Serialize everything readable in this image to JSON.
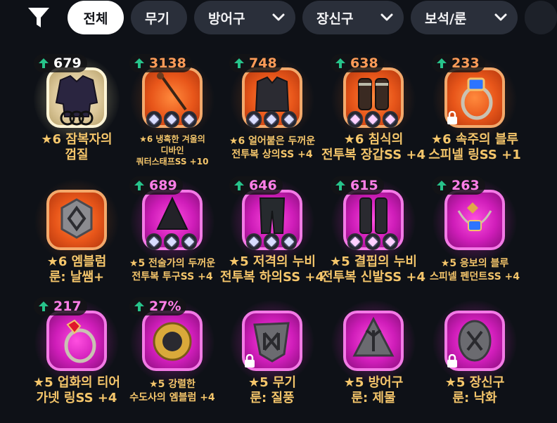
{
  "filters": {
    "all": "전체",
    "weapon": "무기",
    "armor": "방어구",
    "accessory": "장신구",
    "gem_rune": "보석/룬"
  },
  "items": [
    {
      "score": "679",
      "name_line1": "★6 잠복자의",
      "name_line2": "껍질",
      "grade": "gold",
      "score_color": "white"
    },
    {
      "score": "3138",
      "name_line1": "★6 냉혹한 겨울의",
      "name_line2": "디바인",
      "name_line3": "쿼터스태프SS +10",
      "grade": "orange",
      "score_color": "orange"
    },
    {
      "score": "748",
      "name_line1": "★6 얼어붙은 두꺼운",
      "name_line2": "전투복 상의SS +4",
      "grade": "orange",
      "score_color": "orange"
    },
    {
      "score": "638",
      "name_line1": "★6 침식의",
      "name_line2": "전투복 장갑SS +4",
      "grade": "orange",
      "score_color": "orange"
    },
    {
      "score": "233",
      "name_line1": "★6 속주의 블루",
      "name_line2": "스피넬 링SS +1",
      "grade": "orange",
      "score_color": "orange",
      "locked": true
    },
    {
      "score": "",
      "name_line1": "★6 엠블럼",
      "name_line2": "룬: 날쌤+",
      "grade": "orange",
      "score_color": "orange"
    },
    {
      "score": "689",
      "name_line1": "★5 전술가의 두꺼운",
      "name_line2": "전투복 투구SS +4",
      "grade": "pink",
      "score_color": "pink"
    },
    {
      "score": "646",
      "name_line1": "★5 저격의 누비",
      "name_line2": "전투복 하의SS +4",
      "grade": "pink",
      "score_color": "pink"
    },
    {
      "score": "615",
      "name_line1": "★5 결핍의 누비",
      "name_line2": "전투복 신발SS +4",
      "grade": "pink",
      "score_color": "pink"
    },
    {
      "score": "263",
      "name_line1": "★5 응보의 블루",
      "name_line2": "스피넬 펜던트SS +4",
      "grade": "pink",
      "score_color": "pink"
    },
    {
      "score": "217",
      "name_line1": "★5 업화의 티어",
      "name_line2": "가넷 링SS +4",
      "grade": "pink",
      "score_color": "pink"
    },
    {
      "score": "27%",
      "name_line1": "★5 강렬한",
      "name_line2": "수도사의 엠블럼 +4",
      "grade": "pink",
      "score_color": "pink"
    },
    {
      "score": "",
      "name_line1": "★5 무기",
      "name_line2": "룬: 질풍",
      "grade": "pink",
      "score_color": "pink",
      "locked": true
    },
    {
      "score": "",
      "name_line1": "★5 방어구",
      "name_line2": "룬: 제물",
      "grade": "pink",
      "score_color": "pink"
    },
    {
      "score": "",
      "name_line1": "★5 장신구",
      "name_line2": "룬: 낙화",
      "grade": "pink",
      "score_color": "pink",
      "locked": true
    }
  ],
  "colors": {
    "background": "#0e1117",
    "chip": "#2a2f3a",
    "chip_active": "#ffffff",
    "name_text": "#f5c66b",
    "up_arrow": "#27c38a",
    "pink_glow": "#cf1db9",
    "orange_glow": "#e8561a"
  },
  "icons": {
    "filter": "filter-icon",
    "chevron": "chevron-down-icon",
    "upgrade": "arrow-up-icon",
    "lock": "lock-icon"
  }
}
